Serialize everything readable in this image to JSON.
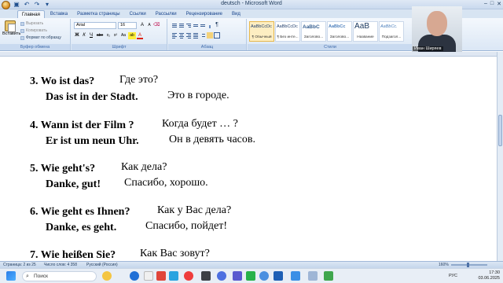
{
  "window": {
    "title": "deutsch - Microsoft Word",
    "controls": [
      "–",
      "□",
      "✕"
    ]
  },
  "tabs": [
    "Главная",
    "Вставка",
    "Разметка страницы",
    "Ссылки",
    "Рассылки",
    "Рецензирование",
    "Вид"
  ],
  "ribbon": {
    "clipboard": {
      "paste_label": "Вставить",
      "cut_label": "Вырезать",
      "copy_label": "Копировать",
      "format_painter_label": "Формат по образцу",
      "group_label": "Буфер обмена"
    },
    "font": {
      "family": "Arial",
      "size": "16",
      "buttons": [
        "Ж",
        "К",
        "Ч",
        "abe",
        "x₂",
        "x²",
        "Aa",
        "ab",
        "A"
      ],
      "group_label": "Шрифт"
    },
    "paragraph": {
      "group_label": "Абзац"
    },
    "styles": {
      "tiles": [
        {
          "sample": "AaBbCcDc",
          "name": "¶ Обычный"
        },
        {
          "sample": "AaBbCcDc",
          "name": "¶ Без инте..."
        },
        {
          "sample": "AaBbC",
          "name": "Заголово..."
        },
        {
          "sample": "AaBbCc",
          "name": "Заголово..."
        },
        {
          "sample": "АаВ",
          "name": "Название"
        },
        {
          "sample": "AaBbCc.",
          "name": "Подзагол..."
        }
      ],
      "group_label": "Стили"
    }
  },
  "webcam": {
    "name": "Иван Ширяев"
  },
  "document": {
    "entries": [
      {
        "q_de": "3. Wo ist das?",
        "q_ru": "Где это?",
        "a_de": "Das ist in der Stadt.",
        "a_ru": "Это в городе."
      },
      {
        "q_de": "4. Wann ist der Film ?",
        "q_ru": "Когда будет … ?",
        "a_de": "Er ist um neun Uhr.",
        "a_ru": "Он в девять часов."
      },
      {
        "q_de": "5. Wie geht's?",
        "q_ru": "Как дела?",
        "a_de": "Danke, gut!",
        "a_ru": "Спасибо, хорошо."
      },
      {
        "q_de": "6. Wie geht es Ihnen?",
        "q_ru": "Как у Вас дела?",
        "a_de": "Danke, es geht.",
        "a_ru": "Спасибо, пойдет!"
      },
      {
        "q_de": "7. Wie heißen Sie?",
        "q_ru": "Как Вас зовут?",
        "a_de": "",
        "a_ru": ""
      }
    ]
  },
  "statusbar": {
    "page": "Страница: 2 из 25",
    "words": "Число слов: 4 358",
    "language": "Русский (Россия)",
    "zoom": "160%"
  },
  "taskbar": {
    "search_placeholder": "Поиск",
    "lang": "РУС",
    "time": "17:30",
    "date": "03.06.2025"
  },
  "colors": {
    "ribbon_accent": "#15428b",
    "selected_style": "#fdeec2"
  }
}
